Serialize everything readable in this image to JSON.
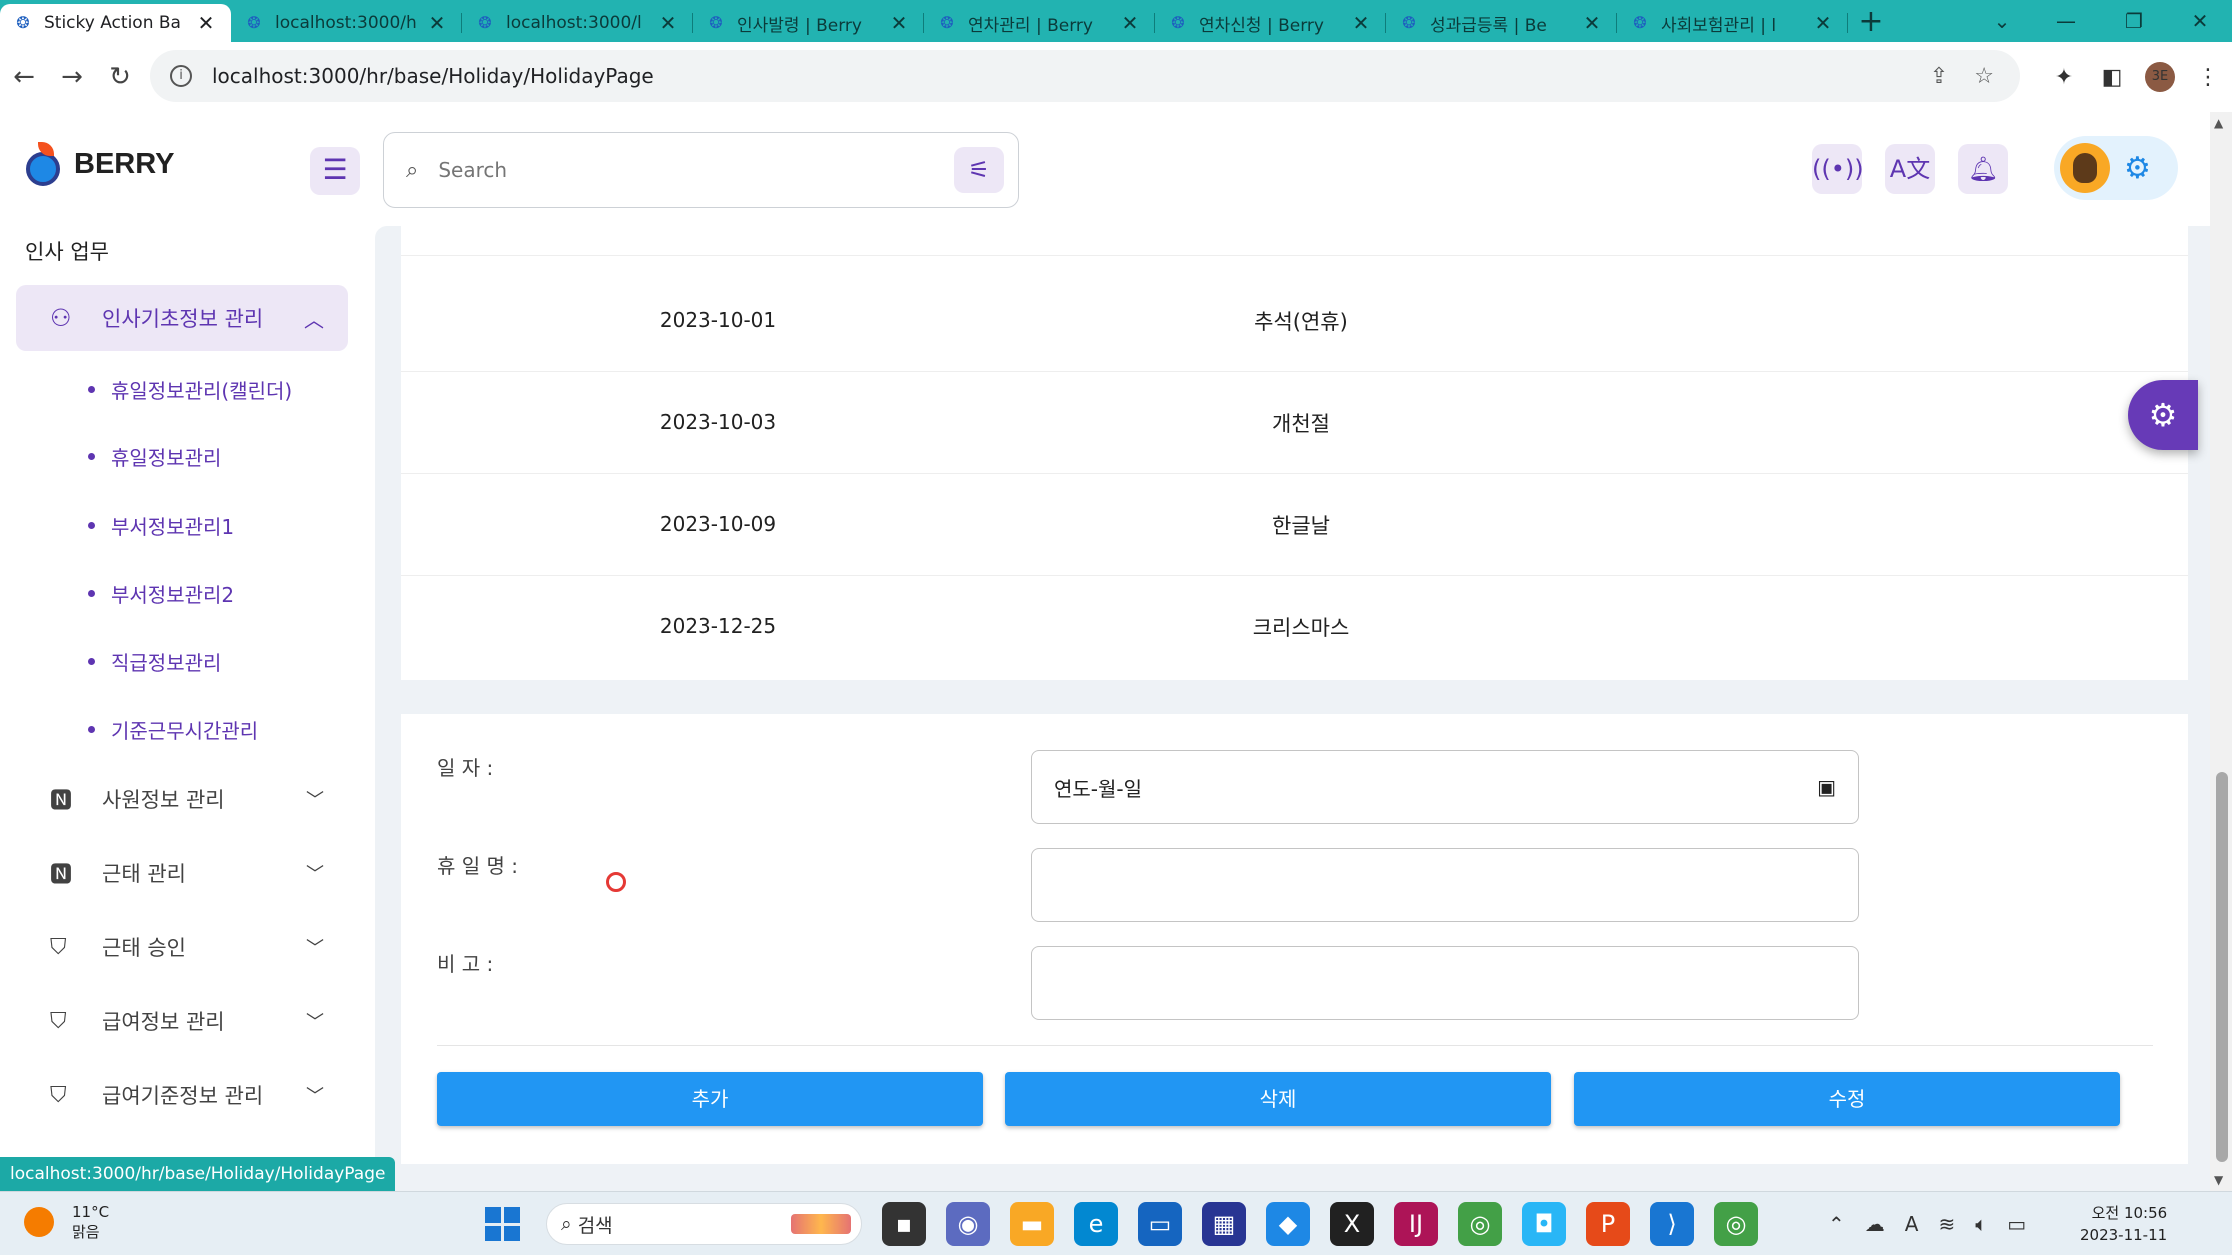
{
  "browser": {
    "tabs": [
      {
        "title": "Sticky Action Ba",
        "active": true
      },
      {
        "title": "localhost:3000/h",
        "active": false
      },
      {
        "title": "localhost:3000/l",
        "active": false
      },
      {
        "title": "인사발령 | Berry",
        "active": false
      },
      {
        "title": "연차관리 | Berry",
        "active": false
      },
      {
        "title": "연차신청 | Berry",
        "active": false
      },
      {
        "title": "성과급등록 | Be",
        "active": false
      },
      {
        "title": "사회보험관리 | l",
        "active": false
      }
    ],
    "url": "localhost:3000/hr/base/Holiday/HolidayPage",
    "profile_initials": "3E",
    "status_url": "localhost:3000/hr/base/Holiday/HolidayPage"
  },
  "app": {
    "logo_text": "BERRY",
    "search_placeholder": "Search"
  },
  "sidebar": {
    "caption": "인사 업무",
    "active_group": "인사기초정보 관리",
    "sub_items": [
      "휴일정보관리(캘린더)",
      "휴일정보관리",
      "부서정보관리1",
      "부서정보관리2",
      "직급정보관리",
      "기준근무시간관리"
    ],
    "groups": [
      {
        "label": "사원정보 관리",
        "icon": "id-card-icon"
      },
      {
        "label": "근태 관리",
        "icon": "id-card-icon"
      },
      {
        "label": "근태 승인",
        "icon": "basket-icon"
      },
      {
        "label": "급여정보 관리",
        "icon": "basket-icon"
      },
      {
        "label": "급여기준정보 관리",
        "icon": "basket-icon"
      }
    ]
  },
  "holidays": [
    {
      "date": "2023-10-01",
      "name": "추석(연휴)"
    },
    {
      "date": "2023-10-03",
      "name": "개천절"
    },
    {
      "date": "2023-10-09",
      "name": "한글날"
    },
    {
      "date": "2023-12-25",
      "name": "크리스마스"
    }
  ],
  "form": {
    "date_label": "일 자 :",
    "date_placeholder": "연도-월-일",
    "name_label": "휴 일 명 :",
    "name_value": "",
    "note_label": "비 고 :",
    "note_value": "",
    "add_label": "추가",
    "delete_label": "삭제",
    "edit_label": "수정"
  },
  "taskbar": {
    "temperature": "11°C",
    "weather": "맑음",
    "search_label": "검색",
    "time": "오전 10:56",
    "date": "2023-11-11"
  },
  "colors": {
    "primary_purple": "#5e35b1",
    "button_blue": "#2196f3",
    "tab_strip": "#22b3b1"
  }
}
